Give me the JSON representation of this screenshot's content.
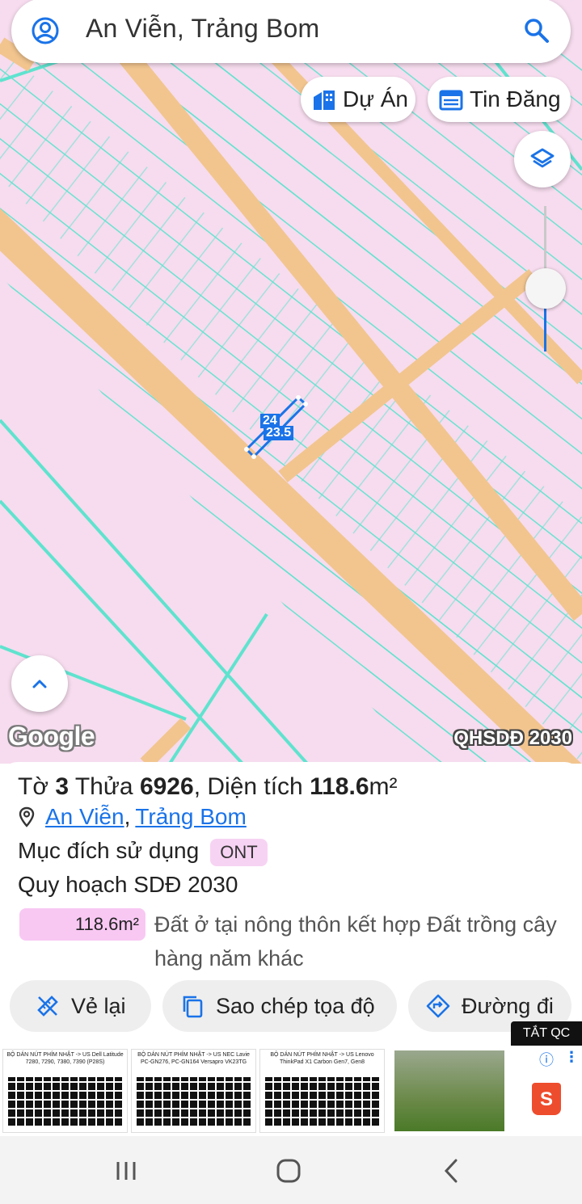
{
  "search": {
    "query": "An Viễn, Trảng Bom"
  },
  "chips": {
    "project": "Dự Án",
    "listing": "Tin Đăng"
  },
  "map": {
    "attribution": "Google",
    "layer_label": "QHSDĐ 2030",
    "parcel_dim_1": "24",
    "parcel_dim_2": "23.5",
    "colors": {
      "land": "#f6dcee",
      "road": "#f2c58f",
      "parcel_line": "#5fe3cf",
      "accent": "#1a73e8"
    }
  },
  "info": {
    "sheet_prefix": "Tờ ",
    "sheet_no": "3",
    "parcel_prefix": " Thửa ",
    "parcel_no": "6926",
    "area_prefix": ", Diện tích ",
    "area_value": "118.6",
    "area_unit": "m²",
    "location_commune": "An Viễn",
    "location_sep": ",",
    "location_district": "Trảng Bom",
    "purpose_label": "Mục đích sử dụng",
    "purpose_code": "ONT",
    "plan_label": "Quy hoạch SDĐ 2030",
    "plan_area": "118.6m²",
    "plan_desc": "Đất ở tại nông thôn kết hợp Đất trồng cây hàng năm khác"
  },
  "actions": {
    "redraw": "Vẻ lại",
    "copy": "Sao chép tọa độ",
    "route": "Đường đi"
  },
  "ad": {
    "close_label": "TẮT QC",
    "items": [
      "BỘ DÁN NÚT PHÍM NHẬT -> US Dell Latitude 7280, 7290, 7380, 7390 (P28S)",
      "BỘ DÁN NÚT PHÍM NHẬT -> US NEC Lavie PC-GN276, PC-GN164 Versapro VK23TG",
      "BỘ DÁN NÚT PHÍM NHẬT -> US Lenovo ThinkPad X1 Carbon Gen7, Gen8"
    ],
    "shop_glyph": "S"
  }
}
